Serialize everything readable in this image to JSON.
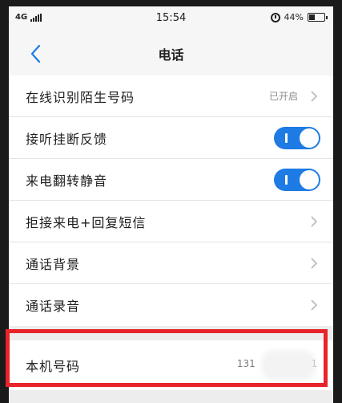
{
  "status_bar": {
    "network": "4G",
    "time": "15:54",
    "battery_text": "44%",
    "battery_level": 0.44,
    "alarm_icon": "alarm-clock-icon"
  },
  "header": {
    "back_icon": "chevron-left-icon",
    "title": "电话"
  },
  "settings": [
    {
      "label": "在线识别陌生号码",
      "status": "已开启",
      "control": "chevron"
    },
    {
      "label": "接听挂断反馈",
      "control": "toggle",
      "enabled": true
    },
    {
      "label": "来电翻转静音",
      "control": "toggle",
      "enabled": true
    },
    {
      "label": "拒接来电+回复短信",
      "control": "chevron"
    },
    {
      "label": "通话背景",
      "control": "chevron"
    },
    {
      "label": "通话录音",
      "control": "chevron"
    }
  ],
  "own_number": {
    "label": "本机号码",
    "value_prefix": "131",
    "value_suffix": "01",
    "masked": true
  },
  "colors": {
    "accent": "#1e7be3",
    "highlight": "#e8242b",
    "background": "#ededed"
  }
}
